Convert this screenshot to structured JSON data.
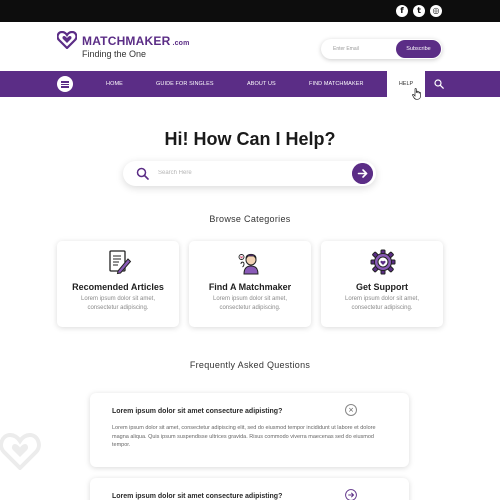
{
  "topbar": {
    "social": [
      {
        "icon": "facebook-icon",
        "glyph": "f"
      },
      {
        "icon": "twitter-icon",
        "glyph": "t"
      },
      {
        "icon": "instagram-icon",
        "glyph": "◎"
      }
    ]
  },
  "header": {
    "brand": "MATCHMAKER",
    "brand_domain": ".com",
    "tagline": "Finding the One",
    "email_placeholder": "Enter Email",
    "subscribe_label": "Subscribe"
  },
  "nav": {
    "items": [
      {
        "label": "HOME"
      },
      {
        "label": "GUIDE FOR SINGLES"
      },
      {
        "label": "ABOUT US"
      },
      {
        "label": "FIND MATCHMAKER"
      }
    ],
    "active_label": "HELP"
  },
  "hero": {
    "title": "Hi! How Can I Help?",
    "search_placeholder": "Search Here"
  },
  "categories": {
    "title": "Browse Categories",
    "cards": [
      {
        "title": "Recomended Articles",
        "desc": "Lorem ipsum dolor sit amet, consectetur adipiscing.",
        "icon": "document-pen-icon"
      },
      {
        "title": "Find A Matchmaker",
        "desc": "Lorem ipsum dolor sit amet, consectetur adipiscing.",
        "icon": "matchmaker-person-icon"
      },
      {
        "title": "Get Support",
        "desc": "Lorem ipsum dolor sit amet, consectetur adipiscing.",
        "icon": "support-gear-icon"
      }
    ]
  },
  "faq": {
    "title": "Frequently Asked Questions",
    "items": [
      {
        "question": "Lorem ipsum dolor sit amet consecture adipisting?",
        "answer": "Lorem ipsum dolor sit amet, consectetur adipiscing elit, sed do eiusmod tempor incididunt ut labore et dolore magna aliqua. Quis ipsum suspendisse ultrices gravida. Risus commodo viverra maecenas sed do eiusmod tempor.",
        "expanded": true,
        "toggle_glyph": "×"
      },
      {
        "question": "Lorem ipsum dolor sit amet consecture adipisting?",
        "expanded": false
      }
    ]
  },
  "colors": {
    "brand": "#5b2d86",
    "topbar": "#0d0d0d",
    "background": "#ffffff"
  }
}
